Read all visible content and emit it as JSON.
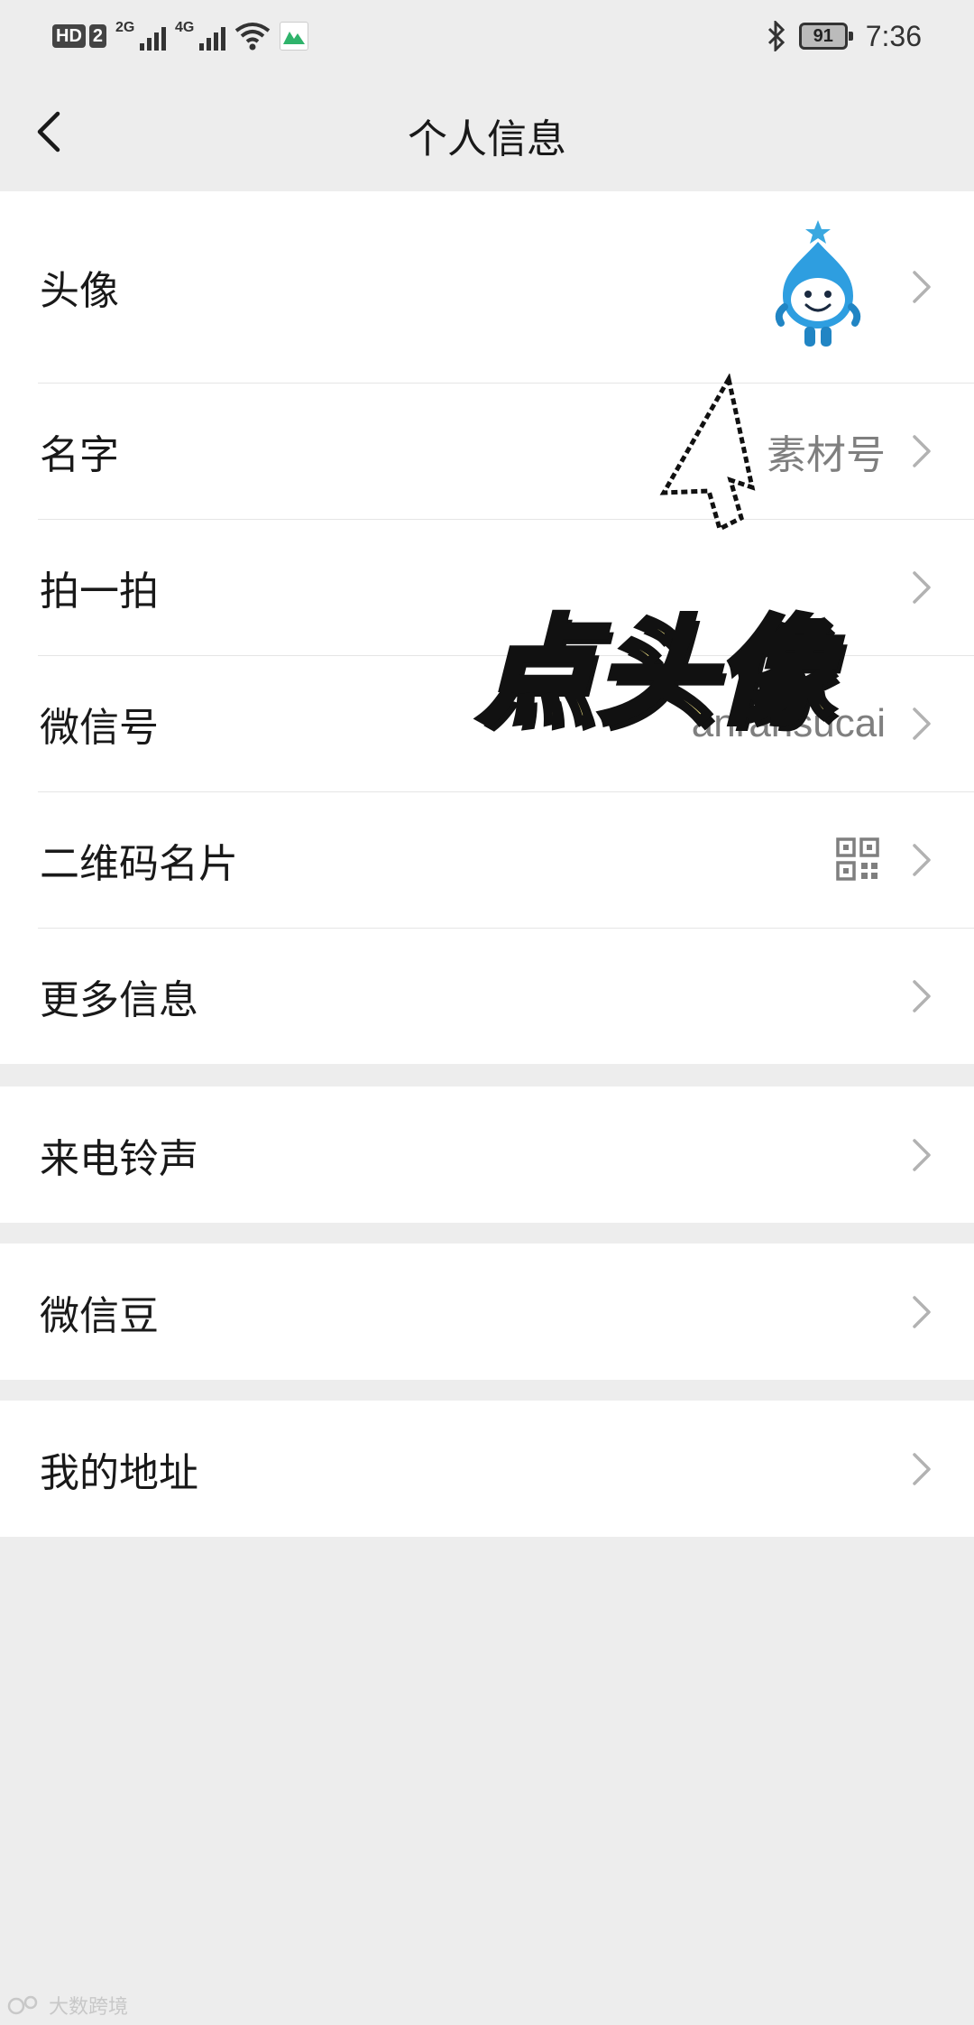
{
  "status_bar": {
    "hd_label": "HD",
    "sim_label": "2",
    "net1_label": "2G",
    "net2_label": "4G",
    "time": "7:36",
    "battery": "91"
  },
  "header": {
    "title": "个人信息"
  },
  "rows": {
    "avatar": {
      "label": "头像"
    },
    "name": {
      "label": "名字",
      "value": "素材号"
    },
    "pat": {
      "label": "拍一拍"
    },
    "wechat_id": {
      "label": "微信号",
      "value": "anransucai"
    },
    "qr": {
      "label": "二维码名片"
    },
    "more": {
      "label": "更多信息"
    },
    "ringtone": {
      "label": "来电铃声"
    },
    "beans": {
      "label": "微信豆"
    },
    "address": {
      "label": "我的地址"
    }
  },
  "overlay": {
    "text": "点头像"
  },
  "watermark": {
    "text": "大数跨境"
  },
  "colors": {
    "page_bg": "#ededed",
    "row_bg": "#ffffff",
    "secondary_text": "#7f7f7f",
    "overlay_fill": "#fdee8a"
  },
  "icons": [
    "back-icon",
    "chevron-right-icon",
    "qr-code-icon",
    "bluetooth-icon",
    "wifi-icon",
    "battery-icon",
    "cursor-icon"
  ]
}
